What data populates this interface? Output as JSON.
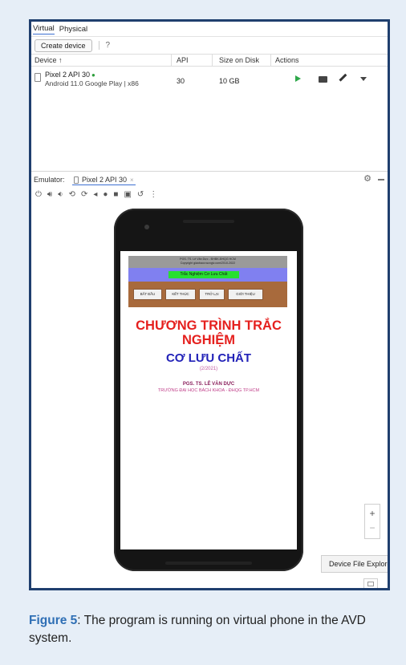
{
  "device_manager": {
    "tabs": [
      "Virtual",
      "Physical"
    ],
    "create_button": "Create device",
    "help": "?",
    "columns": {
      "device": "Device ↑",
      "api": "API",
      "size": "Size on Disk",
      "actions": "Actions"
    },
    "row": {
      "name": "Pixel 2 API 30",
      "subtitle": "Android 11.0 Google Play | x86",
      "api": "30",
      "size": "10 GB"
    }
  },
  "emulator": {
    "label": "Emulator:",
    "tab_name": "Pixel 2 API 30",
    "close_glyph": "×",
    "toolbar_icons": [
      "power-icon",
      "volume-up-icon",
      "volume-down-icon",
      "rotate-left-icon",
      "rotate-right-icon",
      "back-icon",
      "home-icon",
      "overview-icon",
      "screenshot-icon",
      "snapshot-icon",
      "more-icon"
    ]
  },
  "app": {
    "header_line1": "PGS. TS. Lê Văn Dực - ĐHBK-ĐHQG HCM",
    "header_line2": "Copyright giáobaov.wcngiv.com/2010-2022",
    "title_chip": "Trắc Nghiệm Cơ Lưu Chất",
    "menu": [
      "BẮT ĐẦU",
      "KẾT THÚC",
      "TRỞ LẠI",
      "GIỚI THIỆU"
    ],
    "program_title_line1": "CHƯƠNG TRÌNH TRẮC",
    "program_title_line2": "NGHIỆM",
    "subject": "CƠ LƯU CHẤT",
    "year": "(2/2021)",
    "author": "PGS. TS. LÊ VĂN DỰC",
    "school": "TRƯỜNG ĐẠI HỌC BÁCH KHOA - ĐHQG TP.HCM"
  },
  "side": {
    "zoom_in": "+",
    "zoom_out": "−",
    "tooltip": "Device File Explorer"
  },
  "caption": {
    "label": "Figure 5",
    "text": ": The program is running on virtual phone in the AVD system."
  },
  "colors": {
    "frame": "#1f3f6e",
    "play": "#2fa84a",
    "title_red": "#e5201e",
    "subject_blue": "#2222b8",
    "band": "#8080f0",
    "menu_brown": "#a86a3c",
    "chip_green": "#27e02f"
  }
}
